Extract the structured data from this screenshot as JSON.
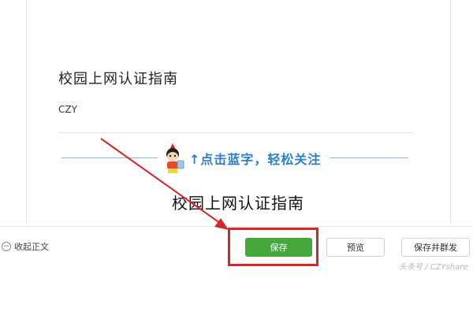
{
  "article": {
    "title": "校园上网认证指南",
    "author": "CZY"
  },
  "banner": {
    "text": "↑点击蓝字，轻松关注",
    "accent_color": "#2b7fc8"
  },
  "content": {
    "title": "校园上网认证指南"
  },
  "footer": {
    "collapse_label": "收起正文",
    "save_label": "保存",
    "preview_label": "预览",
    "publish_label": "保存并群发"
  },
  "watermark": "头条号 / CZYshare",
  "colors": {
    "save_green": "#44a83c",
    "annotation_red": "#d7262b"
  }
}
